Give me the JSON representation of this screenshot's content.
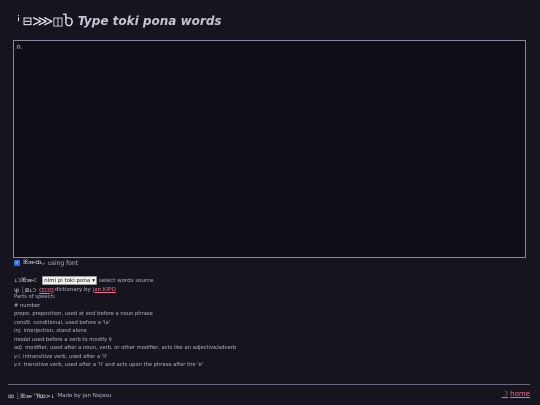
{
  "header": {
    "glyph_title": "ꜞ⊟⋙◫Ⴆ",
    "title": "Type toki pona words"
  },
  "editor": {
    "caret_glyph": "ꗝ"
  },
  "font_toggle": {
    "checkmark": "✓",
    "glyph_label": "ꕤ⋙ꝏ◡",
    "label": "using font"
  },
  "source": {
    "glyph_label": "↓⊃ꕤ⋙⊂",
    "selected": "nimi pi toki pona",
    "label": "select words source"
  },
  "dictionary": {
    "glyph_label": "ꝕ⎿⊞↓⊃",
    "link_glyph": "ꝎꞫꞬ",
    "text": "dictionary by",
    "author": "jan KIPO"
  },
  "parts_of_speech": {
    "heading": "Parts of speech:",
    "items": [
      {
        "abbr": "#",
        "desc": "number"
      },
      {
        "abbr": "prepo.",
        "desc": "preposition, used at end before a noun phrase"
      },
      {
        "abbr": "condit.",
        "desc": "conditional, used before a 'la'"
      },
      {
        "abbr": "inj.",
        "desc": "interjection, stand alone"
      },
      {
        "abbr": "modal",
        "desc": "used before a verb to modify it"
      },
      {
        "abbr": "adj.",
        "desc": "modifier, used after a noun, verb, or other modifier, acts like an adjective/adverb"
      },
      {
        "abbr": "v.i.",
        "desc": "intransitive verb, used after a 'li'"
      },
      {
        "abbr": "v.t.",
        "desc": "transitive verb, used after a 'li' and acts upon the phrase after the 'e'"
      }
    ]
  },
  "footer": {
    "glyph_text": "ꝏ⎿ꕤ⋙ꜛꞪꝏ⋗↓",
    "made_by": "Made by jan Najasu"
  },
  "home": {
    "icon": "☽",
    "label": "home"
  },
  "colors": {
    "background": "#16141f",
    "link": "#ef6f8f",
    "checkbox": "#2f6fe0"
  }
}
